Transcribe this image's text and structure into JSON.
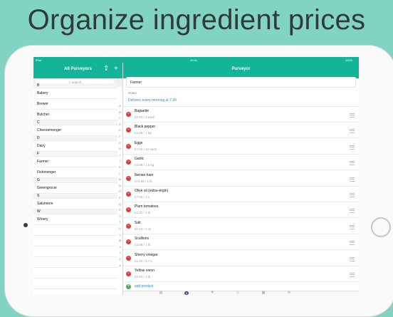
{
  "headline": "Organize ingredient prices",
  "status": {
    "left": "iPad",
    "time": "09:41",
    "battery": "100%"
  },
  "left_nav": {
    "title": "All Purveyors",
    "share_icon": "share-icon",
    "add_icon": "plus-icon"
  },
  "search": {
    "placeholder": "Search"
  },
  "purveyors": [
    {
      "label": "B",
      "section": true
    },
    {
      "label": "Bakery",
      "section": false
    },
    {
      "label": "Brewer",
      "section": false
    },
    {
      "label": "Butcher",
      "section": false
    },
    {
      "label": "C",
      "section": true
    },
    {
      "label": "Cheesemonger",
      "section": false
    },
    {
      "label": "D",
      "section": true
    },
    {
      "label": "Dairy",
      "section": false
    },
    {
      "label": "F",
      "section": true
    },
    {
      "label": "Farmer",
      "section": false
    },
    {
      "label": "Fishmonger",
      "section": false
    },
    {
      "label": "G",
      "section": true
    },
    {
      "label": "Greengrocer",
      "section": false
    },
    {
      "label": "S",
      "section": true
    },
    {
      "label": "Salumiere",
      "section": false
    },
    {
      "label": "W",
      "section": true
    },
    {
      "label": "Winery",
      "section": false
    }
  ],
  "index_letters": [
    "A",
    "B",
    "C",
    "D",
    "E",
    "F",
    "G",
    "H",
    "I",
    "J",
    "K",
    "L",
    "M",
    "N",
    "O",
    "P",
    "Q",
    "R",
    "S",
    "T",
    "U",
    "V",
    "W",
    "X",
    "Y",
    "Z",
    "#"
  ],
  "right_nav": {
    "title": "Purveyor"
  },
  "purveyor": {
    "name": "Farmer",
    "notes_label": "Notes",
    "notes": "Delivers every morning at 7:30"
  },
  "products": [
    {
      "name": "Baguette",
      "price": "£1.00 / 2 each"
    },
    {
      "name": "Black pepper",
      "price": "£1.00 / 1 kg"
    },
    {
      "name": "Eggs",
      "price": "£7.00 / 12 each"
    },
    {
      "name": "Garlic",
      "price": "£0.99 / 1.5 kg"
    },
    {
      "name": "Iberian ham",
      "price": "£71.66 / 1 lb"
    },
    {
      "name": "Olive oil (extra-virgin)",
      "price": "£7.00 / 1 L"
    },
    {
      "name": "Plum tomatoes",
      "price": "£2.37 / 1 lb"
    },
    {
      "name": "Salt",
      "price": "£0.04 / 1 oz"
    },
    {
      "name": "Scallions",
      "price": "£2.68 / 1 lb"
    },
    {
      "name": "Sherry vinegar",
      "price": "£1.00 / 0.7 L"
    },
    {
      "name": "Yellow onion",
      "price": "£1.00 / 1 lb"
    }
  ],
  "add_product": "add product",
  "tabs": [
    {
      "icon": "purveyor-tab-icon",
      "glyph": "▤",
      "active": false
    },
    {
      "icon": "dollar-tab-icon",
      "glyph": "$",
      "active": true
    },
    {
      "icon": "flask-tab-icon",
      "glyph": "⚗",
      "active": false
    },
    {
      "icon": "box-tab-icon",
      "glyph": "◇",
      "active": false
    },
    {
      "icon": "calendar-tab-icon",
      "glyph": "▦",
      "active": false
    },
    {
      "icon": "settings-tab-icon",
      "glyph": "⚙",
      "active": false
    }
  ],
  "colors": {
    "accent": "#13b497",
    "background": "#81d4c2",
    "delete": "#e53935",
    "add": "#4caf50",
    "link": "#2a8fb7"
  }
}
